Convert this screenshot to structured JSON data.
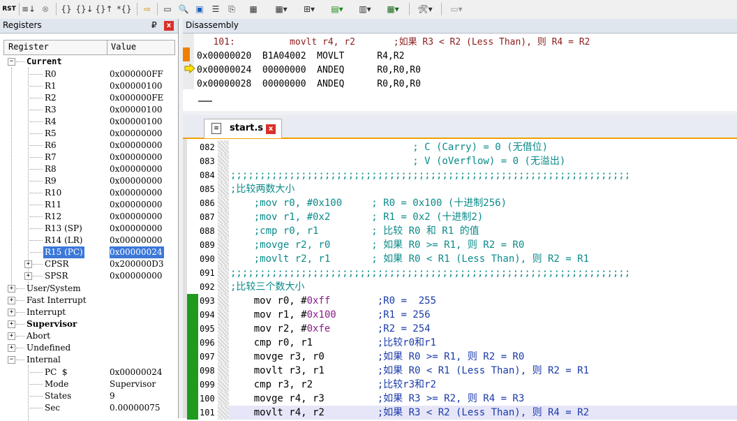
{
  "toolbar": {
    "items": [
      "RST",
      "≡↓",
      "⊗",
      "{}",
      "{}↓",
      "{}↑",
      "*{}",
      "⇨",
      "▭",
      "🔍",
      "▣",
      "☰",
      "⎘",
      "▦",
      "▦▾",
      "⊞▾",
      "▤▾",
      "▥▾",
      "▦▾",
      "🛠▾",
      "▭▾"
    ]
  },
  "registers": {
    "title": "Registers",
    "pin": "₽",
    "close": "x",
    "col_register": "Register",
    "col_value": "Value",
    "current_label": "Current",
    "rows": [
      {
        "name": "R0",
        "value": "0x000000FF"
      },
      {
        "name": "R1",
        "value": "0x00000100"
      },
      {
        "name": "R2",
        "value": "0x000000FE"
      },
      {
        "name": "R3",
        "value": "0x00000100"
      },
      {
        "name": "R4",
        "value": "0x00000100"
      },
      {
        "name": "R5",
        "value": "0x00000000"
      },
      {
        "name": "R6",
        "value": "0x00000000"
      },
      {
        "name": "R7",
        "value": "0x00000000"
      },
      {
        "name": "R8",
        "value": "0x00000000"
      },
      {
        "name": "R9",
        "value": "0x00000000"
      },
      {
        "name": "R10",
        "value": "0x00000000"
      },
      {
        "name": "R11",
        "value": "0x00000000"
      },
      {
        "name": "R12",
        "value": "0x00000000"
      },
      {
        "name": "R13 (SP)",
        "value": "0x00000000"
      },
      {
        "name": "R14 (LR)",
        "value": "0x00000000"
      },
      {
        "name": "R15 (PC)",
        "value": "0x00000024"
      },
      {
        "name": "CPSR",
        "value": "0x200000D3"
      },
      {
        "name": "SPSR",
        "value": "0x00000000"
      }
    ],
    "groups": [
      "User/System",
      "Fast Interrupt",
      "Interrupt",
      "Supervisor",
      "Abort",
      "Undefined",
      "Internal"
    ],
    "internal": [
      {
        "name": "PC  $",
        "value": "0x00000024"
      },
      {
        "name": "Mode",
        "value": "Supervisor"
      },
      {
        "name": "States",
        "value": "9"
      },
      {
        "name": "Sec",
        "value": "0.00000075"
      }
    ]
  },
  "disassembly": {
    "title": "Disassembly",
    "lines": [
      "   101:          movlt r4, r2       ;如果 R3 < R2 (Less Than), 则 R4 = R2",
      "0x00000020  B1A04002  MOVLT      R4,R2",
      "0x00000024  00000000  ANDEQ      R0,R0,R0",
      "0x00000028  00000000  ANDEQ      R0,R0,R0"
    ]
  },
  "editor": {
    "tab_label": "start.s",
    "tab_close": "x",
    "lines": [
      {
        "num": "082",
        "text": "                               ; C (Carry) = 0 (无借位)",
        "kind": "comment",
        "bar": "none"
      },
      {
        "num": "083",
        "text": "                               ; V (oVerflow) = 0 (无溢出)",
        "kind": "comment",
        "bar": "none"
      },
      {
        "num": "084",
        "text": ";;;;;;;;;;;;;;;;;;;;;;;;;;;;;;;;;;;;;;;;;;;;;;;;;;;;;;;;;;;;;;;;;;;;",
        "kind": "comment",
        "bar": "none"
      },
      {
        "num": "085",
        "text": ";比较两数大小",
        "kind": "comment",
        "bar": "none"
      },
      {
        "num": "086",
        "text": "    ;mov r0, #0x100     ; R0 = 0x100 (十进制256)",
        "kind": "comment",
        "bar": "none"
      },
      {
        "num": "087",
        "text": "    ;mov r1, #0x2       ; R1 = 0x2 (十进制2)",
        "kind": "comment",
        "bar": "none"
      },
      {
        "num": "088",
        "text": "    ;cmp r0, r1         ; 比较 R0 和 R1 的值",
        "kind": "comment",
        "bar": "none"
      },
      {
        "num": "089",
        "text": "    ;movge r2, r0       ; 如果 R0 >= R1, 则 R2 = R0",
        "kind": "comment",
        "bar": "none"
      },
      {
        "num": "090",
        "text": "    ;movlt r2, r1       ; 如果 R0 < R1 (Less Than), 则 R2 = R1",
        "kind": "comment",
        "bar": "none"
      },
      {
        "num": "091",
        "text": ";;;;;;;;;;;;;;;;;;;;;;;;;;;;;;;;;;;;;;;;;;;;;;;;;;;;;;;;;;;;;;;;;;;;",
        "kind": "comment",
        "bar": "none"
      },
      {
        "num": "092",
        "text": ";比较三个数大小",
        "kind": "comment",
        "bar": "none"
      },
      {
        "num": "093",
        "code": "    mov r0, #",
        "numtok": "0xff",
        "rest": "        ;R0 =  255",
        "kind": "code",
        "bar": "green"
      },
      {
        "num": "094",
        "code": "    mov r1, #",
        "numtok": "0x100",
        "rest": "       ;R1 = 256",
        "kind": "code",
        "bar": "green"
      },
      {
        "num": "095",
        "code": "    mov r2, #",
        "numtok": "0xfe",
        "rest": "        ;R2 = 254",
        "kind": "code",
        "bar": "green"
      },
      {
        "num": "096",
        "code": "    cmp r0, r1",
        "numtok": "",
        "rest": "           ;比较r0和r1",
        "kind": "code",
        "bar": "green"
      },
      {
        "num": "097",
        "code": "    movge r3, r0",
        "numtok": "",
        "rest": "         ;如果 R0 >= R1, 则 R2 = R0",
        "kind": "code",
        "bar": "green"
      },
      {
        "num": "098",
        "code": "    movlt r3, r1",
        "numtok": "",
        "rest": "         ;如果 R0 < R1 (Less Than), 则 R2 = R1",
        "kind": "code",
        "bar": "green"
      },
      {
        "num": "099",
        "code": "    cmp r3, r2",
        "numtok": "",
        "rest": "           ;比较r3和r2",
        "kind": "code",
        "bar": "green"
      },
      {
        "num": "100",
        "code": "    movge r4, r3",
        "numtok": "",
        "rest": "         ;如果 R3 >= R2, 则 R4 = R3",
        "kind": "code",
        "bar": "green"
      },
      {
        "num": "101",
        "code": "    movlt r4, r2",
        "numtok": "",
        "rest": "         ;如果 R3 < R2 (Less Than), 则 R4 = R2",
        "kind": "code",
        "bar": "green",
        "current": true
      }
    ]
  },
  "colors": {
    "green_bar": "#1f9a1f",
    "orange_marker": "#f08000",
    "selection": "#3b78d8",
    "tab_accent": "#f0a000"
  }
}
